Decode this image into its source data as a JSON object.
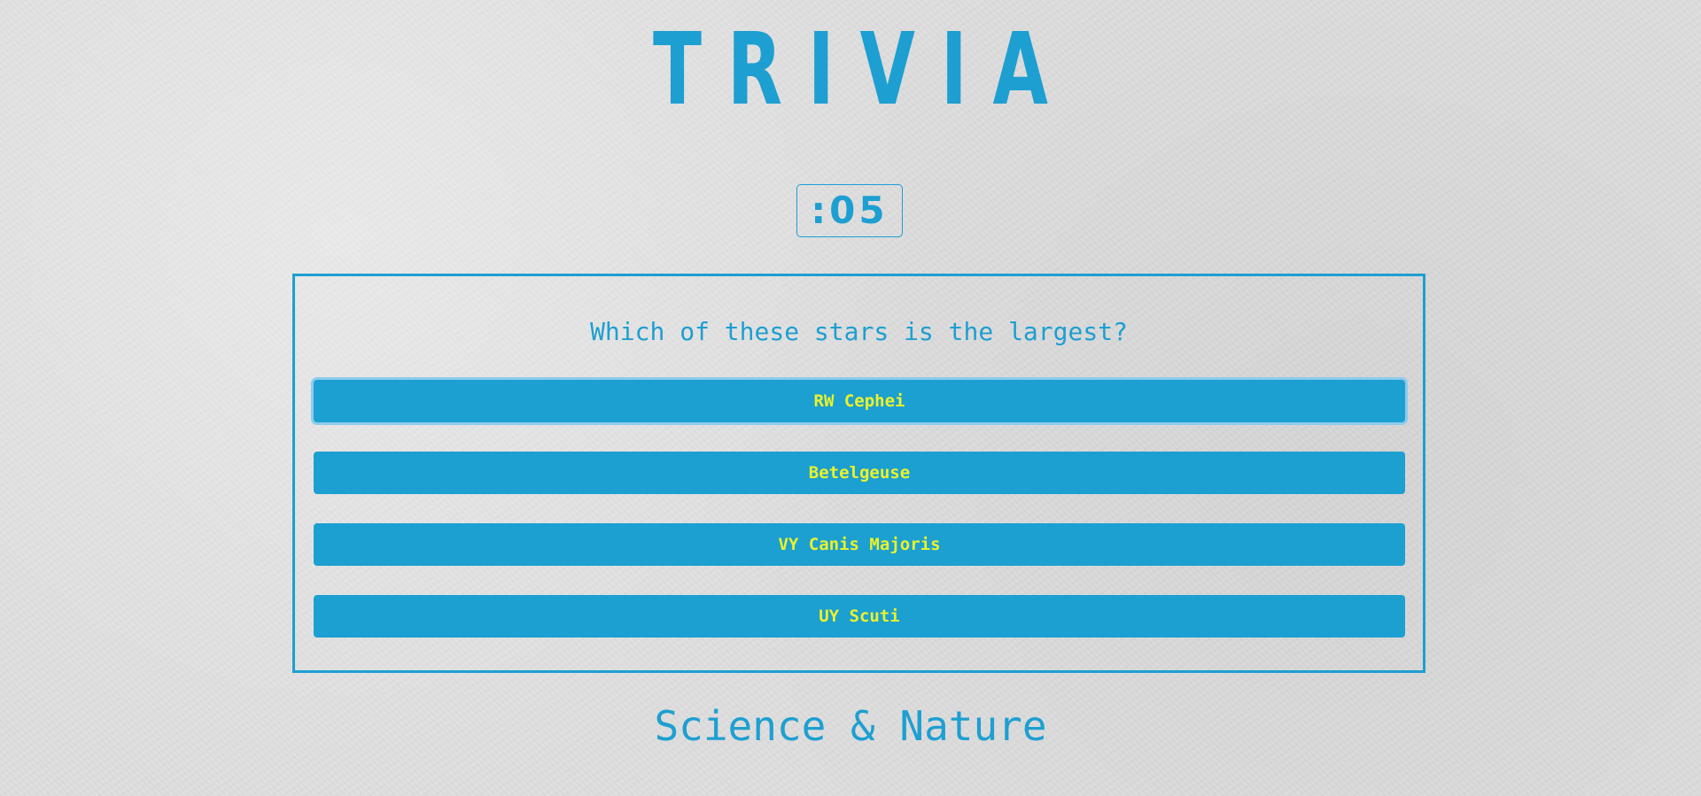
{
  "header": {
    "title": "TRIVIA"
  },
  "timer": {
    "value": ":05"
  },
  "quiz": {
    "question": "Which of these stars is the largest?",
    "answers": [
      {
        "label": "RW Cephei",
        "selected": true
      },
      {
        "label": "Betelgeuse",
        "selected": false
      },
      {
        "label": "VY Canis Majoris",
        "selected": false
      },
      {
        "label": "UY Scuti",
        "selected": false
      }
    ]
  },
  "footer": {
    "category": "Science & Nature"
  },
  "colors": {
    "accent": "#1d9fd1",
    "answer_text": "#eaf22a",
    "background": "#dedede"
  }
}
